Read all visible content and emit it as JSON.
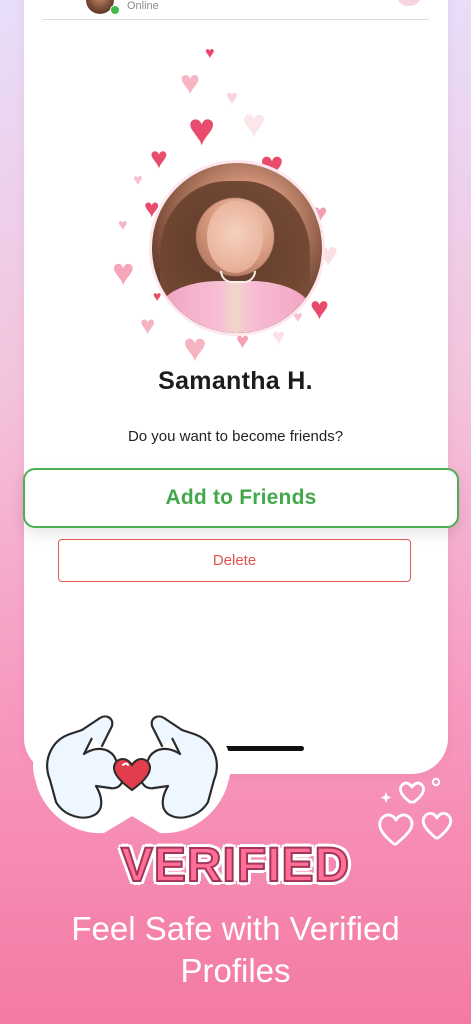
{
  "header": {
    "status": "Online"
  },
  "profile": {
    "name": "Samantha H.",
    "question": "Do you want to become friends?"
  },
  "actions": {
    "add_label": "Add to Friends",
    "delete_label": "Delete"
  },
  "promo": {
    "headline": "VERIFIED",
    "tagline": "Feel Safe with Verified Profiles"
  },
  "colors": {
    "accent_green": "#43a84a",
    "delete_red": "#e0574e",
    "headline_pink": "#ff6f96",
    "heart_red": "#e84e6a",
    "heart_pink": "#f7b3c4"
  },
  "icons": [
    "heart-icon",
    "heart-hands-sticker-icon",
    "online-dot-icon"
  ]
}
